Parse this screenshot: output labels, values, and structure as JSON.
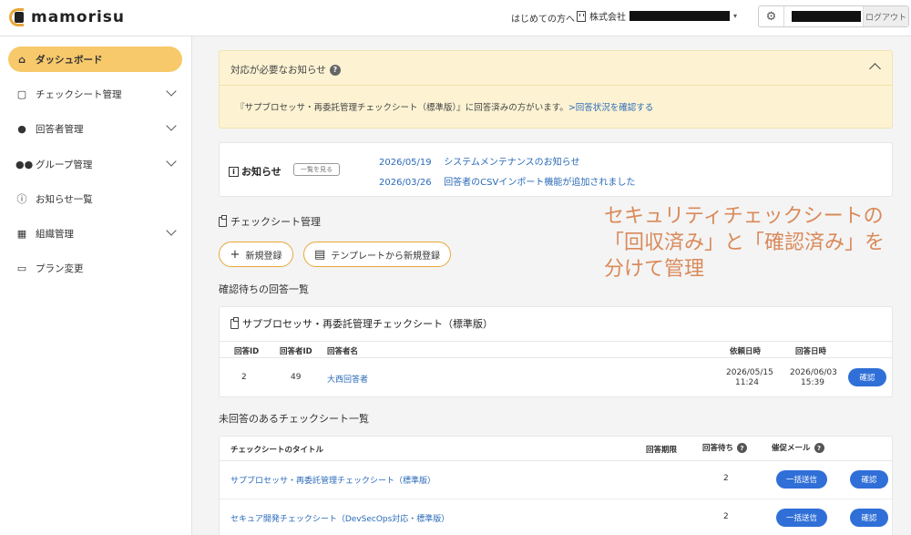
{
  "header": {
    "logo_text": "mamorisu",
    "first_time_link": "はじめての方へ",
    "company": "株式会社",
    "logout": "ログアウト"
  },
  "sidebar": {
    "items": [
      {
        "label": "ダッシュボード",
        "icon": "home-icon",
        "active": true
      },
      {
        "label": "チェックシート管理",
        "icon": "clipboard-icon",
        "expandable": true
      },
      {
        "label": "回答者管理",
        "icon": "person-icon",
        "expandable": true
      },
      {
        "label": "グループ管理",
        "icon": "group-icon",
        "expandable": true
      },
      {
        "label": "お知らせ一覧",
        "icon": "info-icon"
      },
      {
        "label": "組織管理",
        "icon": "building-icon",
        "expandable": true
      },
      {
        "label": "プラン変更",
        "icon": "card-icon"
      }
    ]
  },
  "notice": {
    "title": "対応が必要なお知らせ",
    "body": "『サプブロセッサ・再委託管理チェックシート（標準版）』に回答済みの方がいます。",
    "link": ">回答状況を確認する"
  },
  "news": {
    "title": "お知らせ",
    "view_all": "一覧を見る",
    "items": [
      {
        "date": "2026/05/19",
        "text": "システムメンテナンスのお知らせ"
      },
      {
        "date": "2026/03/26",
        "text": "回答者のCSVインポート機能が追加されました"
      }
    ]
  },
  "checksheet": {
    "section_title": "チェックシート管理",
    "new_button": "新規登録",
    "template_button": "テンプレートから新規登録",
    "confirm_list_title": "確認待ちの回答一覧",
    "confirm_card_title": "サプブロセッサ・再委託管理チェックシート（標準版）",
    "columns": [
      "回答ID",
      "回答者ID",
      "回答者名",
      "依頼日時",
      "回答日時"
    ],
    "rows": [
      {
        "answer_id": "2",
        "respondent_id": "49",
        "name": "大西回答者",
        "requested_date": "2026/05/15",
        "requested_time": "11:24",
        "answered_date": "2026/06/03",
        "answered_time": "15:39",
        "action": "確認"
      }
    ]
  },
  "pending": {
    "title": "未回答のあるチェックシート一覧",
    "columns": [
      "チェックシートのタイトル",
      "回答期限",
      "回答待ち",
      "催促メール"
    ],
    "rows": [
      {
        "title": "サプブロセッサ・再委託管理チェックシート（標準版）",
        "waiting": "2",
        "bulk": "一括送信",
        "action": "確認"
      },
      {
        "title": "セキュア開発チェックシート（DevSecOps対応・標準版）",
        "waiting": "2",
        "bulk": "一括送信",
        "action": "確認"
      }
    ]
  },
  "overlay": {
    "line1": "セキュリティチェックシートの",
    "line2": "「回収済み」と「確認済み」を",
    "line3": "分けて管理"
  },
  "colors": {
    "accent": "#f7c96b",
    "accent_border": "#e8a73a",
    "link": "#2a6ab8",
    "button": "#2f6fd7",
    "overlay": "#d98a5a"
  }
}
